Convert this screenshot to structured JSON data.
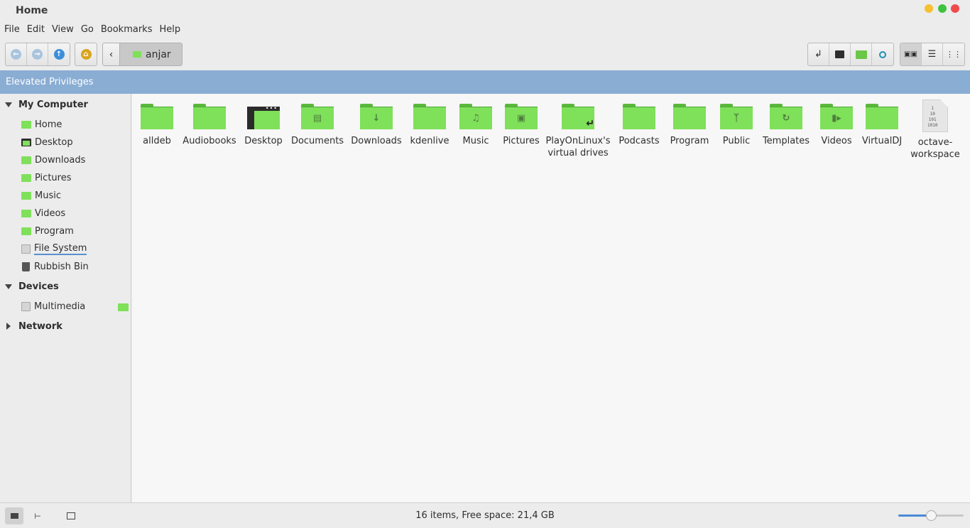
{
  "window": {
    "title": "Home"
  },
  "menu": [
    "File",
    "Edit",
    "View",
    "Go",
    "Bookmarks",
    "Help"
  ],
  "location": {
    "current": "anjar"
  },
  "banner": "Elevated Privileges",
  "sidebar": {
    "my_computer": {
      "label": "My Computer",
      "items": [
        {
          "label": "Home",
          "icon": "home-folder-icon"
        },
        {
          "label": "Desktop",
          "icon": "desktop-icon"
        },
        {
          "label": "Downloads",
          "icon": "downloads-folder-icon"
        },
        {
          "label": "Pictures",
          "icon": "pictures-folder-icon"
        },
        {
          "label": "Music",
          "icon": "music-folder-icon"
        },
        {
          "label": "Videos",
          "icon": "videos-folder-icon"
        },
        {
          "label": "Program",
          "icon": "folder-icon"
        },
        {
          "label": "File System",
          "icon": "drive-icon"
        },
        {
          "label": "Rubbish Bin",
          "icon": "trash-icon"
        }
      ]
    },
    "devices": {
      "label": "Devices",
      "items": [
        {
          "label": "Multimedia",
          "icon": "drive-icon"
        }
      ]
    },
    "network": {
      "label": "Network"
    }
  },
  "files": [
    {
      "name": "alldeb",
      "icon": "folder-icon"
    },
    {
      "name": "Audiobooks",
      "icon": "folder-icon"
    },
    {
      "name": "Desktop",
      "icon": "desktop-icon"
    },
    {
      "name": "Documents",
      "icon": "documents-folder-icon"
    },
    {
      "name": "Downloads",
      "icon": "downloads-folder-icon"
    },
    {
      "name": "kdenlive",
      "icon": "folder-icon"
    },
    {
      "name": "Music",
      "icon": "music-folder-icon"
    },
    {
      "name": "Pictures",
      "icon": "pictures-folder-icon"
    },
    {
      "name": "PlayOnLinux's virtual drives",
      "icon": "symlink-folder-icon"
    },
    {
      "name": "Podcasts",
      "icon": "folder-icon"
    },
    {
      "name": "Program",
      "icon": "folder-icon"
    },
    {
      "name": "Public",
      "icon": "public-folder-icon"
    },
    {
      "name": "Templates",
      "icon": "templates-folder-icon"
    },
    {
      "name": "Videos",
      "icon": "videos-folder-icon"
    },
    {
      "name": "VirtualDJ",
      "icon": "folder-icon"
    },
    {
      "name": "octave-workspace",
      "icon": "binary-file-icon"
    }
  ],
  "status": {
    "text": "16 items, Free space: 21,4 GB",
    "zoom_level": 0.5
  },
  "colors": {
    "folder": "#7fe05a",
    "banner": "#8aadd4",
    "accent": "#4a88d8"
  }
}
